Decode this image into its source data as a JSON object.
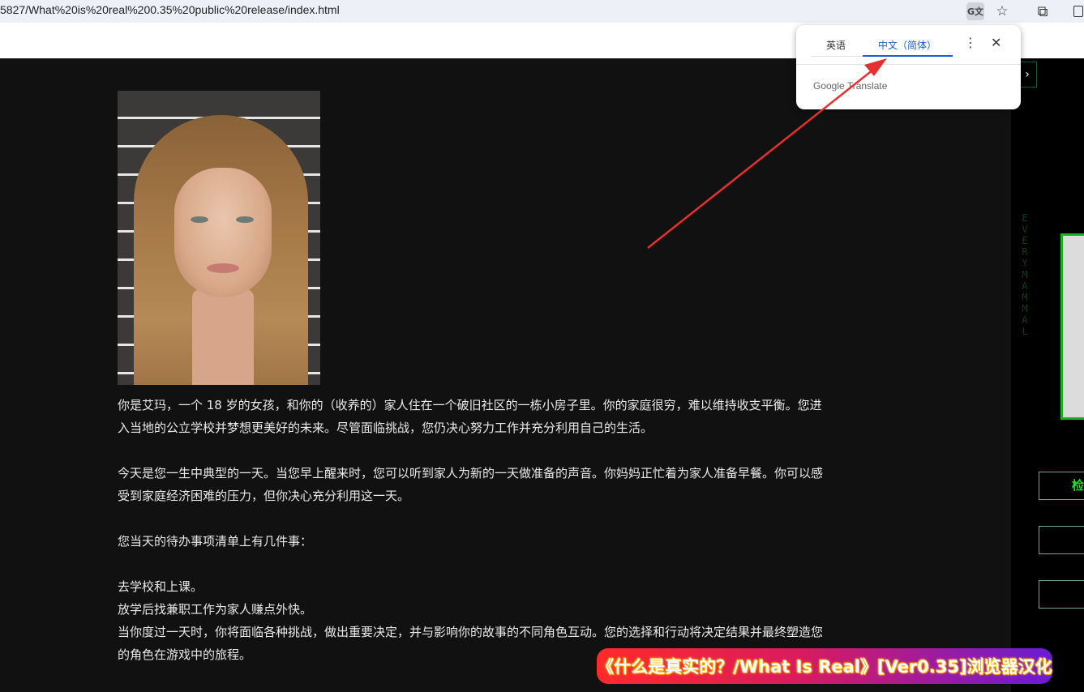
{
  "browser": {
    "url": "5827/What%20is%20real%200.35%20public%20release/index.html",
    "icons": [
      "translate-icon",
      "star-icon",
      "extensions-icon",
      "side-panel-icon"
    ]
  },
  "translate_popup": {
    "tab_source": "英语",
    "tab_target": "中文（简体）",
    "more_label": "⋮",
    "close_label": "✕",
    "brand": "Google Translate"
  },
  "story": {
    "paragraphs": [
      "你是艾玛，一个 18 岁的女孩，和你的（收养的）家人住在一个破旧社区的一栋小房子里。你的家庭很穷，难以维持收支平衡。您进入当地的公立学校并梦想更美好的未来。尽管面临挑战，您仍决心努力工作并充分利用自己的生活。",
      "今天是您一生中典型的一天。当您早上醒来时，您可以听到家人为新的一天做准备的声音。你妈妈正忙着为家人准备早餐。你可以感受到家庭经济困难的压力，但你决心充分利用这一天。",
      "您当天的待办事项清单上有几件事：",
      "去学校和上课。",
      "放学后找兼职工作为家人赚点外快。",
      "当你度过一天时，你将面临各种挑战，做出重要决定，并与影响你的故事的不同角色互动。您的选择和行动将决定结果并最终塑造您的角色在游戏中的旅程。"
    ]
  },
  "sidebar": {
    "nav_arrow": "›",
    "check_label": "检",
    "matrix_text": "EVERYMAMMAL"
  },
  "banner": {
    "text": "《什么是真实的？/What Is Real》[Ver0.35]浏览器汉化"
  },
  "colors": {
    "accent_blue": "#1a5fd0",
    "arrow_red": "#e53030",
    "matrix_green": "#1db21d"
  }
}
